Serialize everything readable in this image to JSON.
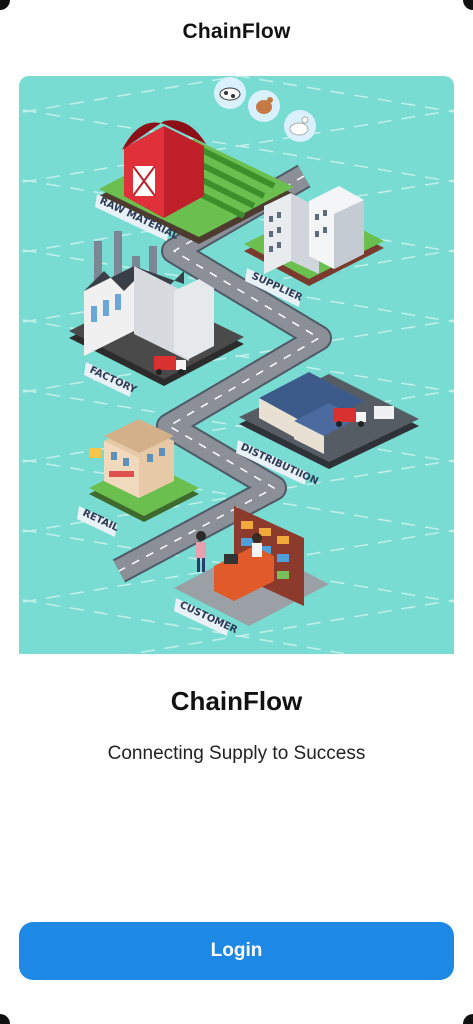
{
  "header": {
    "title": "ChainFlow"
  },
  "hero": {
    "labels": {
      "raw_material": "RAW MATERIAL",
      "supplier": "SUPPLIER",
      "factory": "FACTORY",
      "distribution": "DISTRIBUTIION",
      "retail": "RETAIL",
      "customer": "CUSTOMER"
    }
  },
  "main": {
    "brand_title": "ChainFlow",
    "tagline": "Connecting Supply to Success"
  },
  "actions": {
    "login_label": "Login"
  },
  "colors": {
    "primary": "#1e88e5",
    "hero_background": "#78dcd2",
    "road": "#8a8f98"
  }
}
